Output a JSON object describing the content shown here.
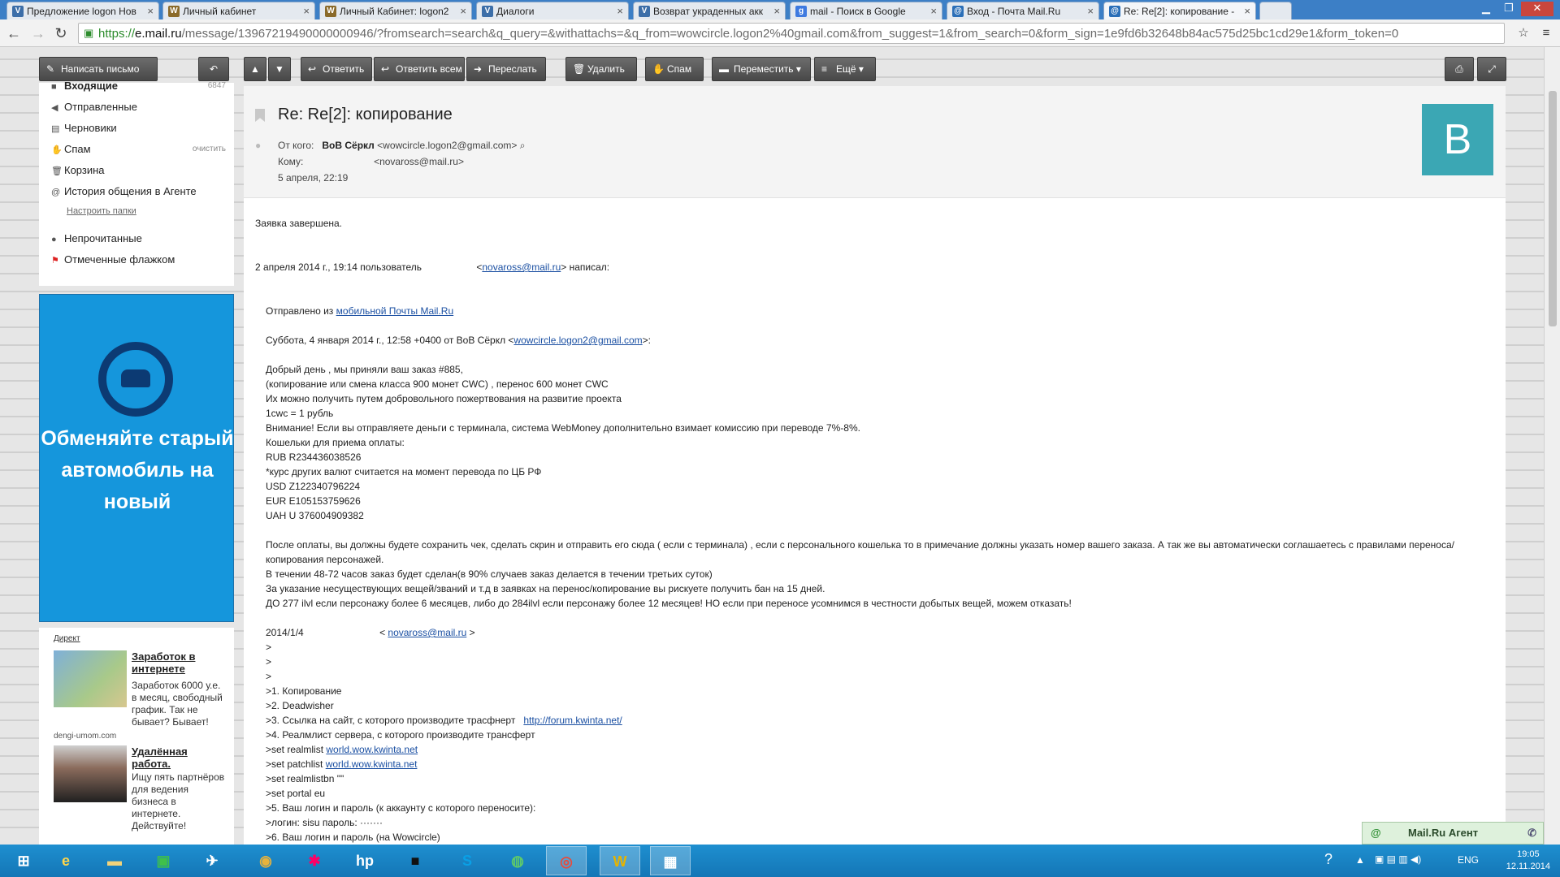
{
  "browser": {
    "tabs": [
      {
        "title": "Предложение logon Нов",
        "favicon": "V",
        "color": "#3c6ea8"
      },
      {
        "title": "Личный кабинет",
        "favicon": "W",
        "color": "#8a6a2a"
      },
      {
        "title": "Личный Кабинет: logon2",
        "favicon": "W",
        "color": "#8a6a2a"
      },
      {
        "title": "Диалоги",
        "favicon": "V",
        "color": "#3c6ea8"
      },
      {
        "title": "Возврат украденных акк",
        "favicon": "V",
        "color": "#3c6ea8"
      },
      {
        "title": "mail - Поиск в Google",
        "favicon": "g",
        "color": "#3e7ae0"
      },
      {
        "title": "Вход - Почта Mail.Ru",
        "favicon": "@",
        "color": "#2b6fb8"
      },
      {
        "title": "Re: Re[2]: копирование -",
        "favicon": "@",
        "color": "#2b6fb8"
      }
    ],
    "close_glyph": "×",
    "url_scheme": "https://",
    "url_host": "e.mail.ru",
    "url_path": "/message/13967219490000000946/?fromsearch=search&q_query=&withattachs=&q_from=wowcircle.logon2%40gmail.com&from_suggest=1&from_search=0&form_sign=1e9fd6b32648b84ac575d25bc1cd29e1&form_token=0"
  },
  "mail_toolbar": {
    "compose": "Написать письмо",
    "reply": "Ответить",
    "reply_all": "Ответить всем",
    "forward": "Переслать",
    "delete": "Удалить",
    "spam": "Спам",
    "move": "Переместить",
    "more": "Ещё"
  },
  "sidebar": {
    "folders": [
      {
        "label": "Входящие",
        "count": "6847",
        "icon": "inbox-icon"
      },
      {
        "label": "Отправленные",
        "icon": "sent-icon"
      },
      {
        "label": "Черновики",
        "icon": "drafts-icon"
      },
      {
        "label": "Спам",
        "icon": "spam-icon"
      },
      {
        "label": "Корзина",
        "icon": "trash-icon"
      },
      {
        "label": "История общения в Агенте",
        "icon": "history-icon"
      }
    ],
    "clean": "очистить",
    "settings": "Настроить папки",
    "filters": [
      {
        "label": "Непрочитанные"
      },
      {
        "label": "Отмеченные флажком"
      }
    ]
  },
  "promo": {
    "text": "Обменяйте старый автомобиль на новый"
  },
  "direct": {
    "label": "Директ",
    "ads": [
      {
        "title": "Заработок в интернете",
        "text": "Заработок 6000 у.е. в месяц, свободный график. Так не бывает? Бывает!",
        "site": "dengi-umom.com"
      },
      {
        "title": "Удалённая работа.",
        "text": "Ищу пять партнёров для ведения бизнеса в интернете. Действуйте!"
      }
    ]
  },
  "message": {
    "subject": "Re: Re[2]: копирование",
    "from_label": "От кого:",
    "from_name": "ВоВ Сёркл",
    "from_email": "<wowcircle.logon2@gmail.com>",
    "to_label": "Кому:",
    "to_email": "<novaross@mail.ru>",
    "date": "5 апреля, 22:19",
    "avatar_letter": "В",
    "body_top": "Заявка завершена.",
    "quote_intro_a": "2 апреля 2014 г., 19:14 пользователь",
    "quote_intro_link": "novaross@mail.ru",
    "quote_intro_b": "> написал:",
    "sent_from_a": "Отправлено из",
    "sent_from_link": "мобильной Почты Mail.Ru",
    "sat_a": "Суббота, 4 января 2014 г., 12:58 +0400 от ВоВ Сёркл <",
    "sat_link": "wowcircle.logon2@gmail.com",
    "sat_b": ">:",
    "lines1": [
      "Добрый день , мы приняли ваш заказ #885,",
      "(копирование или смена класса 900 монет CWC) , перенос 600 монет CWC",
      "Их можно  получить путем добровольного пожертвования на развитие проекта",
      "1cwc = 1 рубль",
      "Внимание! Если вы отправляете деньги с терминала, система WebMoney  дополнительно взимает комиссию при переводе 7%-8%.",
      "Кошельки для приема оплаты:",
      "RUB R234436038526",
      "*курс других валют считается на момент перевода по ЦБ РФ",
      "USD Z122340796224",
      "EUR E105153759626",
      "UAH  U 376004909382"
    ],
    "lines2": [
      "После оплаты, вы должны будете сохранить чек,  сделать скрин и отправить его сюда ( если с терминала) , если с персонального кошелька то в примечание должны указать номер вашего заказа. А так же вы автоматически соглашаетесь с правилами переноса/копирования персонажей.",
      "В течении 48-72 часов заказ будет сделан(в 90% случаев заказ делается в течении третьих суток)",
      "За указание несуществующих вещей/званий и т.д в заявках на перенос/копирование вы рискуете получить бан на 15 дней.",
      "ДО 277 ilvl если персонажу более 6 месяцев, либо до 284ilvl если персонажу более 12 месяцев! НО если при переносе усомнимся в честности добытых вещей, можем отказать!"
    ],
    "date2": "2014/1/4",
    "date2_link": "novaross@mail.ru",
    "q_lines": [
      ">",
      ">",
      ">",
      ">1. Копирование",
      ">2. Deadwisher"
    ],
    "q3_a": ">3. Ссылка на сайт, с которого производите трасфнерт",
    "q3_link": "http://forum.kwinta.net/",
    "q4": ">4. Реалмлист сервера, с которого производите трансферт",
    "q5_a": ">set realmlist",
    "q5_link": "world.wow.kwinta.net",
    "q6_a": ">set patchlist",
    "q6_link": "world.wow.kwinta.net",
    "q_tail": [
      ">set realmlistbn \"\"",
      ">set portal eu",
      ">5. Ваш логин и пароль (к аккаунту  с  которого переносите):",
      ">логин:  sisu  пароль: ·······",
      ">6. Ваш логин и пароль (на Wowcircle)"
    ]
  },
  "agent": {
    "label": "Mail.Ru Агент"
  },
  "taskbar": {
    "lang": "ENG",
    "time": "19:05",
    "date": "12.11.2014"
  }
}
